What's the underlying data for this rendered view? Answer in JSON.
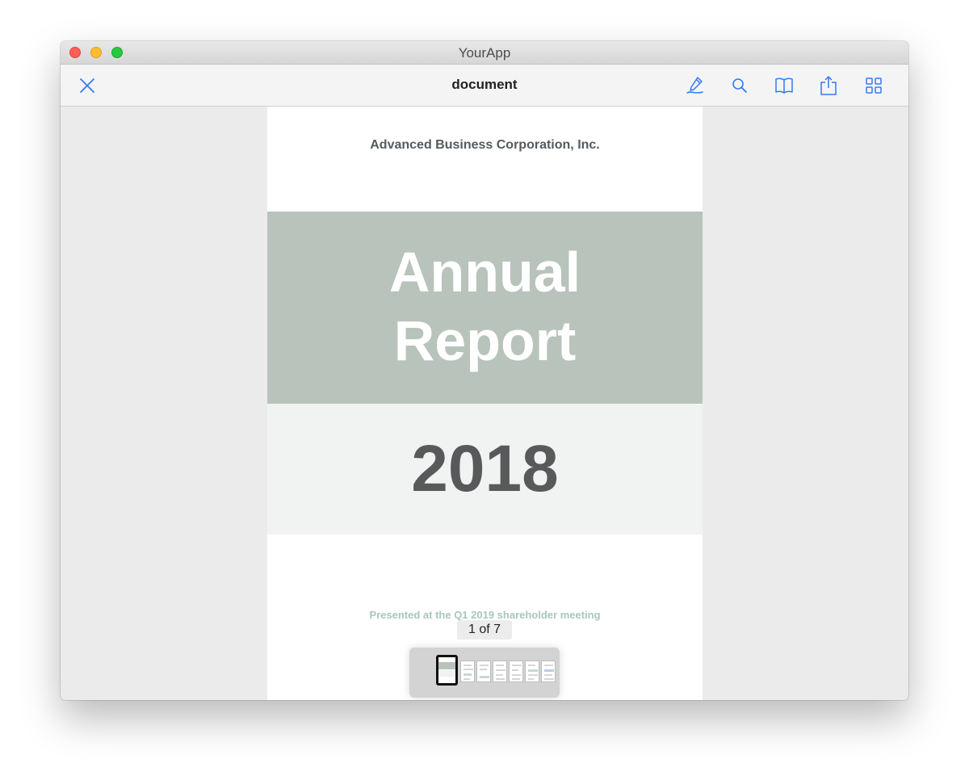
{
  "window": {
    "title": "YourApp"
  },
  "toolbar": {
    "document_title": "document",
    "close_icon": "close-icon",
    "icons": [
      "annotate-pen-icon",
      "search-icon",
      "book-outline-icon",
      "share-icon",
      "grid-icon"
    ]
  },
  "page": {
    "company": "Advanced Business Corporation, Inc.",
    "title_line_1": "Annual",
    "title_line_2": "Report",
    "year": "2018",
    "presented": "Presented at the Q1 2019 shareholder meeting"
  },
  "navigation": {
    "page_indicator": "1 of 7",
    "thumbnail_count": 7,
    "current_page": 1
  },
  "colors": {
    "accent": "#3478f6",
    "title_band": "#b8c3bb",
    "year_band": "#f1f3f2",
    "year_text": "#58595b",
    "presented_text": "#a7c8b9"
  }
}
